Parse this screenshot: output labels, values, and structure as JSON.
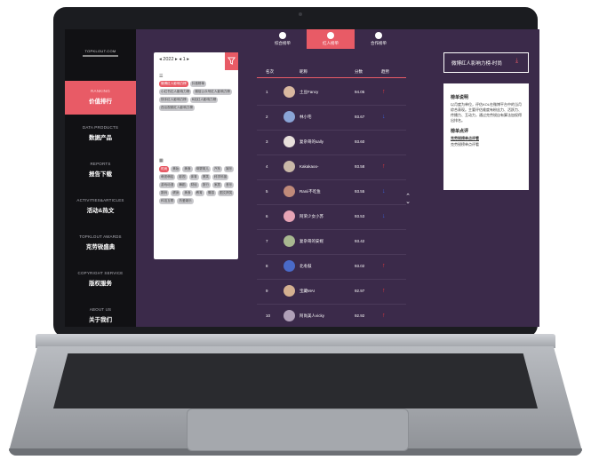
{
  "sidebar": {
    "logo_text": "TOPKLOUT.COM",
    "items": [
      {
        "en": "RANKING",
        "cn": "价值排行",
        "active": true
      },
      {
        "en": "DATA PRODUCTS",
        "cn": "数据产品",
        "active": false
      },
      {
        "en": "REPORTS",
        "cn": "报告下载",
        "active": false
      },
      {
        "en": "ACTIVITIES&ARTICLES",
        "cn": "活动&热文",
        "active": false
      },
      {
        "en": "TOPKLOUT AWARDS",
        "cn": "克劳锐盛典",
        "active": false
      },
      {
        "en": "COPYRIGHT SERVICE",
        "cn": "版权服务",
        "active": false
      },
      {
        "en": "ABOUT US",
        "cn": "关于我们",
        "active": false
      }
    ]
  },
  "tabs": [
    {
      "label": "综合榜单",
      "active": false
    },
    {
      "label": "红人榜单",
      "active": true
    },
    {
      "label": "合作榜单",
      "active": false
    }
  ],
  "filter": {
    "date": "◂ 2022 ▸ ◂ 1 ▸",
    "filter_icon": "funnel-icon",
    "section1_icon": "list-icon",
    "rank_chips": [
      {
        "label": "微博红人影响力榜",
        "on": true
      },
      {
        "label": "抖音榜单",
        "on": false
      },
      {
        "label": "小红书红人影响力榜",
        "on": false
      },
      {
        "label": "微信公众号红人影响力榜",
        "on": false
      },
      {
        "label": "快手红人影响力榜",
        "on": false
      },
      {
        "label": "B站红人影响力榜",
        "on": false
      },
      {
        "label": "西瓜视频红人影响力榜",
        "on": false
      }
    ],
    "section2_icon": "grid-icon",
    "category_chips": [
      {
        "label": "时尚",
        "on": true
      },
      {
        "label": "美妆",
        "on": false
      },
      {
        "label": "美食",
        "on": false
      },
      {
        "label": "母婴育儿",
        "on": false
      },
      {
        "label": "汽车",
        "on": false
      },
      {
        "label": "娱乐",
        "on": false
      },
      {
        "label": "萌宠萌娃",
        "on": false
      },
      {
        "label": "影视",
        "on": false
      },
      {
        "label": "体育",
        "on": false
      },
      {
        "label": "搞笑",
        "on": false
      },
      {
        "label": "科学科普",
        "on": false
      },
      {
        "label": "游戏动漫",
        "on": false
      },
      {
        "label": "舞蹈",
        "on": false
      },
      {
        "label": "财经",
        "on": false
      },
      {
        "label": "旅行",
        "on": false
      },
      {
        "label": "家居",
        "on": false
      },
      {
        "label": "音乐",
        "on": false
      },
      {
        "label": "数码",
        "on": false
      },
      {
        "label": "健身",
        "on": false
      },
      {
        "label": "美食",
        "on": false
      },
      {
        "label": "教育",
        "on": false
      },
      {
        "label": "情感",
        "on": false
      },
      {
        "label": "图文搞笑",
        "on": false
      },
      {
        "label": "科技互联",
        "on": false
      },
      {
        "label": "热爱娱乐",
        "on": false
      }
    ]
  },
  "table": {
    "headers": {
      "rank": "名次",
      "name": "昵称",
      "score": "分数",
      "trend": "趋势"
    },
    "rows": [
      {
        "rank": "1",
        "name": "土豆Fancy",
        "score": "94.05",
        "trend": "↑",
        "dir": "up",
        "avatar": "#d9b8a0"
      },
      {
        "rank": "2",
        "name": "林小宅",
        "score": "93.67",
        "trend": "↓",
        "dir": "down",
        "avatar": "#8aa4d6"
      },
      {
        "rank": "3",
        "name": "复杂哥的sally",
        "score": "93.60",
        "trend": "",
        "dir": "",
        "avatar": "#e8e0dc"
      },
      {
        "rank": "4",
        "name": "Kakakaoo-",
        "score": "93.58",
        "trend": "↑",
        "dir": "up",
        "avatar": "#c9b8a8"
      },
      {
        "rank": "5",
        "name": "Ranii不吃鱼",
        "score": "93.55",
        "trend": "↓",
        "dir": "down",
        "avatar": "#c08a7a"
      },
      {
        "rank": "6",
        "name": "阿荣少女小苏",
        "score": "93.53",
        "trend": "↓",
        "dir": "down",
        "avatar": "#e6a3b5"
      },
      {
        "rank": "7",
        "name": "复杂哥的安妮",
        "score": "93.42",
        "trend": "",
        "dir": "",
        "avatar": "#a8b890"
      },
      {
        "rank": "8",
        "name": "北冬鼓",
        "score": "93.02",
        "trend": "↑",
        "dir": "up",
        "avatar": "#4a6ac8"
      },
      {
        "rank": "9",
        "name": "宝藏MAI",
        "score": "92.97",
        "trend": "↑",
        "dir": "up",
        "avatar": "#d4b090"
      },
      {
        "rank": "10",
        "name": "阿尚美人vicky",
        "score": "92.92",
        "trend": "↑",
        "dir": "up",
        "avatar": "#b0a0b8"
      }
    ]
  },
  "right": {
    "title": "微博红人影响力榜-时尚",
    "download_icon": "download-icon",
    "card": {
      "heading1": "榜单说明",
      "desc": "以月度为单位，评估KOL在微博平台中的当月综合表现。主要评估维度有粉丝力、活跃力、传播力、互动力，通过克劳锐自有算法加权得出排名。",
      "heading2": "榜单点评",
      "link": "克劳锐榜单点评看",
      "sub": "克劳锐榜单点评看"
    }
  },
  "scroll": {
    "up": "⌃",
    "down": "⌄"
  }
}
